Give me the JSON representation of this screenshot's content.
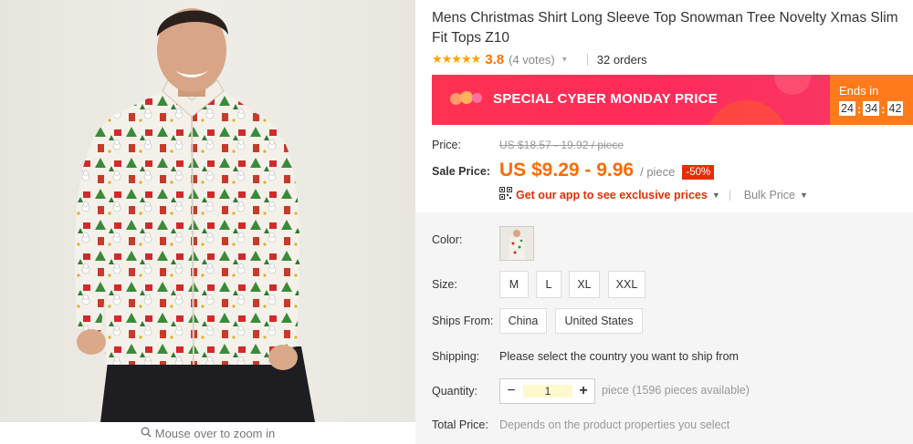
{
  "gallery": {
    "zoom_hint": "Mouse over to zoom in",
    "zoom_icon": "search-icon"
  },
  "product": {
    "title": "Mens Christmas Shirt Long Sleeve Top Snowman Tree Novelty Xmas Slim Fit Tops Z10",
    "stars": "★★★★★",
    "rating": "3.8",
    "votes": "(4 votes)",
    "orders": "32 orders"
  },
  "promo": {
    "banner_text": "SPECIAL CYBER MONDAY PRICE",
    "ends_label": "Ends in",
    "timer": {
      "hours": "24",
      "minutes": "34",
      "seconds": "42",
      "separator": ":"
    },
    "colors": {
      "banner": "#ff3252",
      "ends_bg": "#ff7a1a"
    }
  },
  "pricing": {
    "price_label": "Price:",
    "original_price": "US $18.57 - 19.92 / piece",
    "sale_label": "Sale Price:",
    "sale_price": "US $9.29 - 9.96",
    "unit": "/ piece",
    "discount": "-50%",
    "app_link": "Get our app to see exclusive prices",
    "bulk_price": "Bulk Price",
    "colors": {
      "sale": "#ff6a00",
      "discount_badge": "#e62e04"
    }
  },
  "options": {
    "color_label": "Color:",
    "size_label": "Size:",
    "sizes": [
      "M",
      "L",
      "XL",
      "XXL"
    ],
    "ships_from_label": "Ships From:",
    "ships_from": [
      "China",
      "United States"
    ],
    "shipping_label": "Shipping:",
    "shipping_message": "Please select the country you want to ship from",
    "quantity_label": "Quantity:",
    "quantity_minus": "−",
    "quantity_value": "1",
    "quantity_plus": "+",
    "availability": "piece (1596 pieces available)",
    "total_label": "Total Price:",
    "total_message": "Depends on the product properties you select"
  }
}
